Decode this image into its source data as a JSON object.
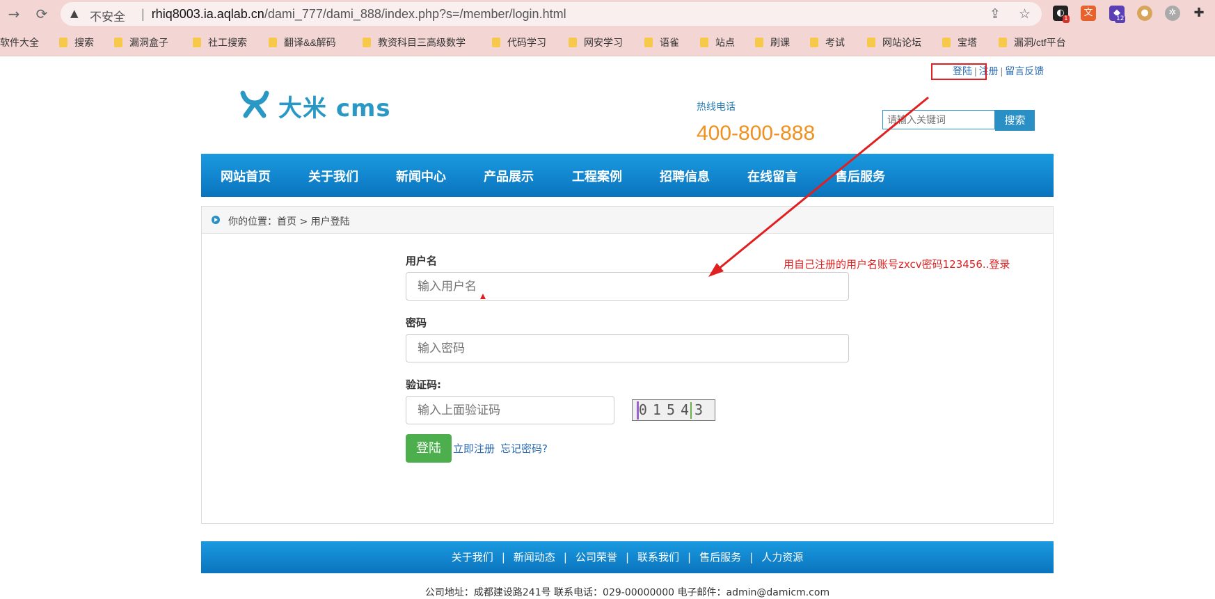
{
  "browser": {
    "insecure_label": "不安全",
    "url_host": "rhiq8003.ia.aqlab.cn",
    "url_path": "/dami_777/dami_888/index.php?s=/member/login.html",
    "ext_badge_1": "1",
    "ext_badge_2": "12"
  },
  "bookmarks": [
    "软件大全",
    "搜索",
    "漏洞盒子",
    "社工搜索",
    "翻译&&解码",
    "教资科目三高级数学",
    "代码学习",
    "网安学习",
    "语雀",
    "站点",
    "刷课",
    "考试",
    "网站论坛",
    "宝塔",
    "漏洞/ctf平台"
  ],
  "header": {
    "top_links": {
      "login": "登陆",
      "register": "注册",
      "feedback": "留言反馈",
      "sep": "|"
    },
    "logo_text": "大米 cms",
    "hotline_label": "热线电话",
    "hotline_number": "400-800-888",
    "search_placeholder": "请输入关键词",
    "search_button": "搜索"
  },
  "nav": [
    "网站首页",
    "关于我们",
    "新闻中心",
    "产品展示",
    "工程案例",
    "招聘信息",
    "在线留言",
    "售后服务"
  ],
  "breadcrumb": "你的位置：首页 > 用户登陆",
  "form": {
    "username_label": "用户名",
    "username_placeholder": "输入用户名",
    "password_label": "密码",
    "password_placeholder": "输入密码",
    "captcha_label": "验证码:",
    "captcha_placeholder": "输入上面验证码",
    "captcha_text": "01543",
    "login_button": "登陆",
    "register_link": "立即注册",
    "forgot_link": "忘记密码?"
  },
  "annotation": "用自己注册的用户名账号zxcv密码123456..登录",
  "footer": {
    "links": [
      "关于我们",
      "新闻动态",
      "公司荣誉",
      "联系我们",
      "售后服务",
      "人力资源"
    ],
    "info": "公司地址：成都建设路241号 联系电话：029-00000000 电子邮件：admin@damicm.com"
  },
  "colors": {
    "chrome_bg": "#f3d6d3",
    "nav_blue": "#0a74be",
    "hotline_orange": "#f0901e",
    "login_green": "#4cae4c",
    "annotation_red": "#e02020"
  }
}
